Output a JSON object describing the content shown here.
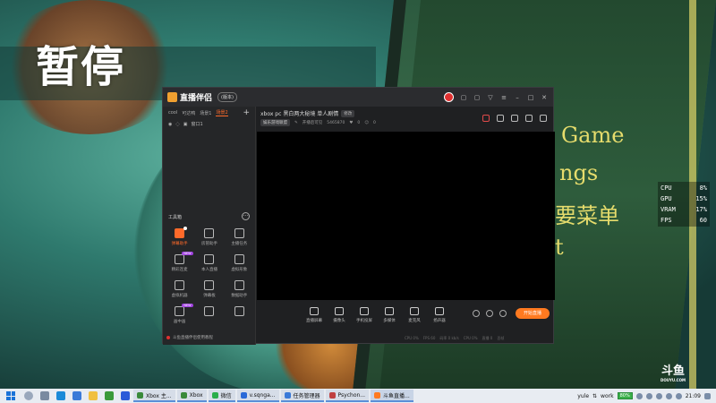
{
  "game": {
    "pause_title": "暂停",
    "menu_lines": [
      "Game",
      "ngs",
      "要菜单",
      "t"
    ],
    "stats": [
      {
        "label": "CPU",
        "value": "8%"
      },
      {
        "label": "GPU",
        "value": "15%"
      },
      {
        "label": "VRAM",
        "value": "17%"
      },
      {
        "label": "FPS",
        "value": "60"
      }
    ],
    "watermark": "斗鱼",
    "watermark_url": "DOUYU.COM"
  },
  "app": {
    "name": "直播伴侣",
    "version_label": "(版本)",
    "scene_tabs": [
      "cool",
      "可达鸭",
      "场景1",
      "场景2"
    ],
    "active_scene_index": 3,
    "source_row_label": "窗口1",
    "toolbox_title": "工具箱",
    "toolbox_more": "···",
    "tools": [
      {
        "label": "弹幕助手",
        "active": true,
        "badge": "",
        "dot": true
      },
      {
        "label": "房管助手",
        "active": false,
        "badge": "",
        "dot": false
      },
      {
        "label": "主播任务",
        "active": false,
        "badge": "",
        "dot": false
      },
      {
        "label": "精彩连麦",
        "active": false,
        "badge": "NEW",
        "dot": false
      },
      {
        "label": "本人直播",
        "active": false,
        "badge": "",
        "dot": false
      },
      {
        "label": "虚拟形象",
        "active": false,
        "badge": "",
        "dot": false
      },
      {
        "label": "虚拟机器",
        "active": false,
        "badge": "",
        "dot": false
      },
      {
        "label": "弹幕板",
        "active": false,
        "badge": "",
        "dot": false
      },
      {
        "label": "数据助手",
        "active": false,
        "badge": "",
        "dot": false
      },
      {
        "label": "画中画",
        "active": false,
        "badge": "NEW",
        "dot": false
      },
      {
        "label": "",
        "active": false,
        "badge": "",
        "dot": false
      },
      {
        "label": "",
        "active": false,
        "badge": "",
        "dot": false
      }
    ],
    "sidebar_footer": "斗鱼直播伴侣使用教程",
    "room_title": "xbox pc 黑白两大秘境 单人剧情",
    "room_title_tag": "修改",
    "room_category": "娱乐游戏联盟",
    "room_status": "开播后可见",
    "room_id": "5465870",
    "room_like": "0",
    "room_fans": "0",
    "bottom_tools": [
      "直播屏幕",
      "摄像头",
      "手机投屏",
      "多媒体",
      "麦克风",
      "扬声器"
    ],
    "live_button": "开始直播",
    "status_bar": [
      "CPU 0%",
      "FPS 60",
      "码率 0 kb/s",
      "CPU 0%",
      "直播 0",
      "丢帧"
    ]
  },
  "taskbar": {
    "apps": [
      {
        "label": "Xbox 主...",
        "color": "#3a8a3a",
        "active": false
      },
      {
        "label": "Xbox",
        "color": "#3a8a3a",
        "active": false
      },
      {
        "label": "微信",
        "color": "#2aae4a",
        "active": false
      },
      {
        "label": "v.sqnga...",
        "color": "#2a6ad8",
        "active": false
      },
      {
        "label": "任务管理器",
        "color": "#3a7ad8",
        "active": false
      },
      {
        "label": "Psychon...",
        "color": "#c04040",
        "active": false
      },
      {
        "label": "斗鱼直播...",
        "color": "#ff7a20",
        "active": true
      }
    ],
    "tray_labels": [
      "yule",
      "work"
    ],
    "battery": "80%",
    "clock": "21:09"
  }
}
